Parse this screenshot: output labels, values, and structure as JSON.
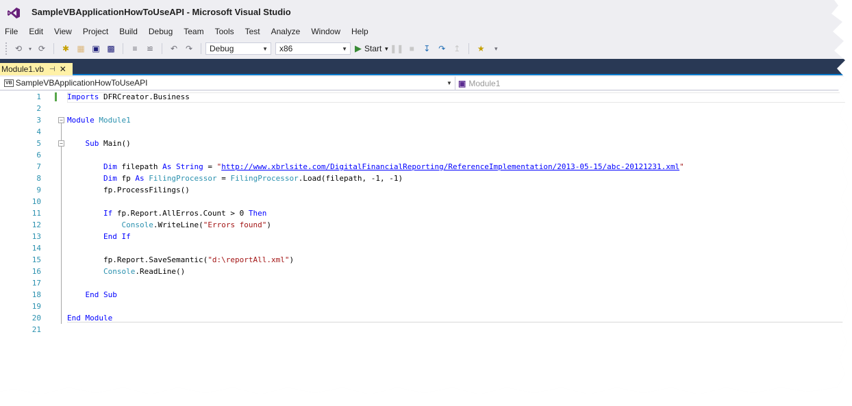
{
  "window": {
    "title": "SampleVBApplicationHowToUseAPI - Microsoft Visual Studio",
    "logo": "visual-studio-logo-icon"
  },
  "menu": [
    "File",
    "Edit",
    "View",
    "Project",
    "Build",
    "Debug",
    "Team",
    "Tools",
    "Test",
    "Analyze",
    "Window",
    "Help"
  ],
  "toolbar": {
    "configuration": "Debug",
    "platform": "x86",
    "start_label": "Start"
  },
  "tab": {
    "label": "Module1.vb",
    "pin_glyph": "⊣",
    "close_glyph": "✕"
  },
  "navbar": {
    "project": "SampleVBApplicationHowToUseAPI",
    "project_badge": "VB",
    "member": "Module1"
  },
  "editor": {
    "line_numbers": [
      "1",
      "2",
      "3",
      "4",
      "5",
      "6",
      "7",
      "8",
      "9",
      "10",
      "11",
      "12",
      "13",
      "14",
      "15",
      "16",
      "17",
      "18",
      "19",
      "20",
      "21"
    ],
    "lines": [
      {
        "kw1": "Imports",
        "rest": " DFRCreator.Business"
      },
      {},
      {
        "kw1": "Module",
        "ty1": " Module1"
      },
      {},
      {
        "indent": "    ",
        "kw1": "Sub",
        "rest": " Main()"
      },
      {},
      {
        "indent": "        ",
        "kw1": "Dim",
        "rest": " filepath ",
        "kw2": "As String",
        "rest2": " = ",
        "str1": "\"",
        "url": "http://www.xbrlsite.com/DigitalFinancialReporting/ReferenceImplementation/2013-05-15/abc-20121231.xml",
        "str2": "\""
      },
      {
        "indent": "        ",
        "kw1": "Dim",
        "rest": " fp ",
        "kw2": "As",
        "ty1": " FilingProcessor",
        "rest2": " = ",
        "ty2": "FilingProcessor",
        "rest3": ".Load(filepath, -1, -1)"
      },
      {
        "indent": "        ",
        "rest": "fp.ProcessFilings()"
      },
      {},
      {
        "indent": "        ",
        "kw1": "If",
        "rest": " fp.Report.AllErros.Count > 0 ",
        "kw2": "Then"
      },
      {
        "indent": "            ",
        "ty1": "Console",
        "rest": ".WriteLine(",
        "str1": "\"Errors found\"",
        "rest2": ")"
      },
      {
        "indent": "        ",
        "kw1": "End If"
      },
      {},
      {
        "indent": "        ",
        "rest": "fp.Report.SaveSemantic(",
        "str1": "\"d:\\reportAll.xml\"",
        "rest2": ")"
      },
      {
        "indent": "        ",
        "ty1": "Console",
        "rest": ".ReadLine()"
      },
      {},
      {
        "indent": "    ",
        "kw1": "End Sub"
      },
      {},
      {
        "kw1": "End Module"
      },
      {}
    ]
  },
  "colors": {
    "keyword": "#0000ff",
    "type": "#2b91af",
    "string": "#a31515",
    "tab_active": "#fff1a7",
    "tab_band": "#293955"
  }
}
